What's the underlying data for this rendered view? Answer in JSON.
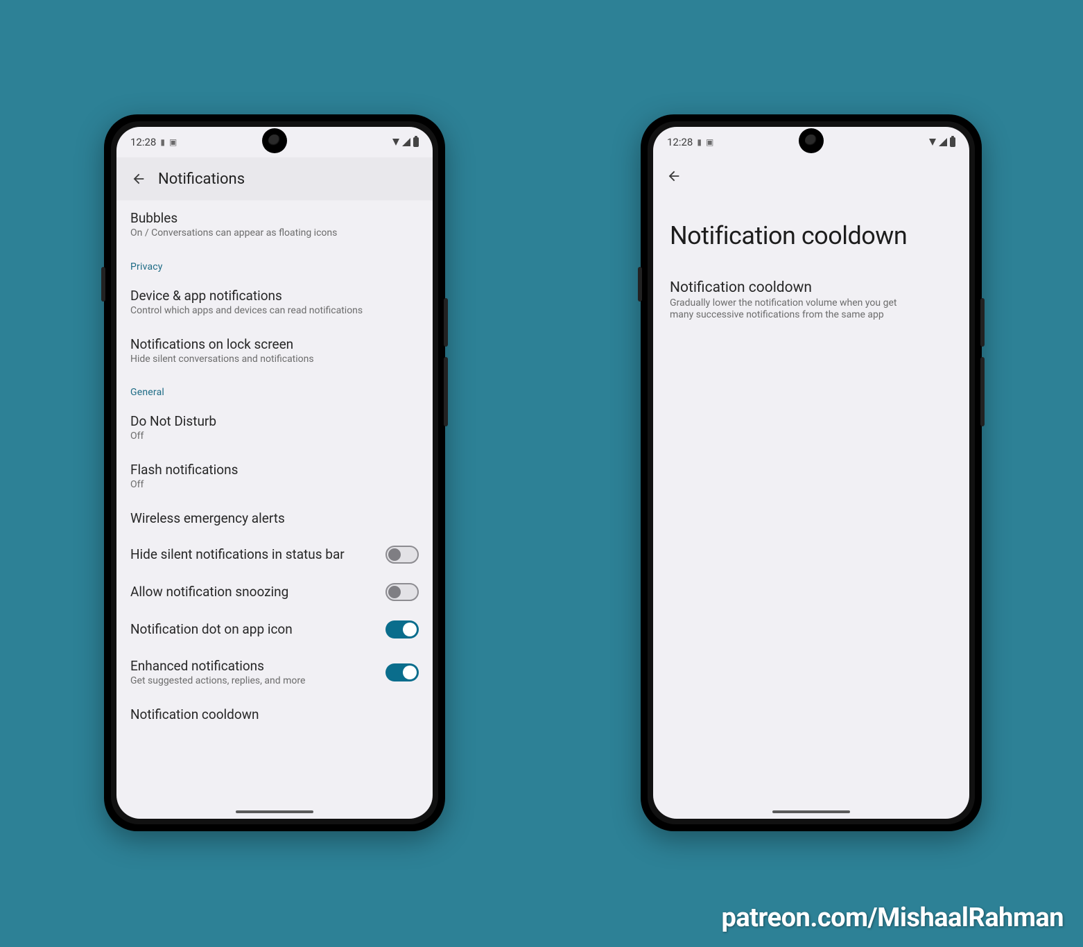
{
  "status": {
    "time": "12:28"
  },
  "watermark": "patreon.com/MishaalRahman",
  "left": {
    "header_title": "Notifications",
    "items": [
      {
        "title": "Bubbles",
        "subtitle": "On / Conversations can appear as floating icons"
      }
    ],
    "section_privacy_label": "Privacy",
    "privacy_items": [
      {
        "title": "Device & app notifications",
        "subtitle": "Control which apps and devices can read notifications"
      },
      {
        "title": "Notifications on lock screen",
        "subtitle": "Hide silent conversations and notifications"
      }
    ],
    "section_general_label": "General",
    "general_items": [
      {
        "title": "Do Not Disturb",
        "subtitle": "Off"
      },
      {
        "title": "Flash notifications",
        "subtitle": "Off"
      },
      {
        "title": "Wireless emergency alerts"
      },
      {
        "title": "Hide silent notifications in status bar",
        "toggle": "off"
      },
      {
        "title": "Allow notification snoozing",
        "toggle": "off"
      },
      {
        "title": "Notification dot on app icon",
        "toggle": "on"
      },
      {
        "title": "Enhanced notifications",
        "subtitle": "Get suggested actions, replies, and more",
        "toggle": "on"
      },
      {
        "title": "Notification cooldown"
      }
    ]
  },
  "right": {
    "large_title": "Notification cooldown",
    "item": {
      "title": "Notification cooldown",
      "subtitle": "Gradually lower the notification volume when you get many successive notifications from the same app"
    }
  }
}
